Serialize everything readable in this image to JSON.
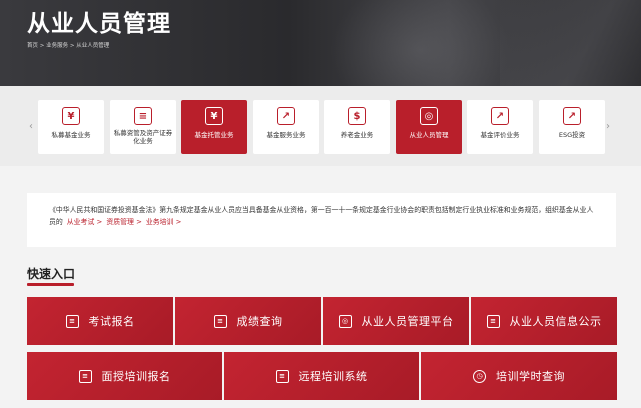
{
  "hero": {
    "title": "从业人员管理",
    "breadcrumb": "首页 > 业务服务 > 从业人员管理"
  },
  "categories": [
    {
      "label": "私募基金业务",
      "icon": "yen-coin-icon",
      "glyph": "¥",
      "active": false
    },
    {
      "label": "私募资管及资产证券化业务",
      "icon": "stacked-coins-icon",
      "glyph": "≡",
      "active": false
    },
    {
      "label": "基金托管业务",
      "icon": "money-hand-icon",
      "glyph": "¥",
      "active": true
    },
    {
      "label": "基金服务业务",
      "icon": "bar-chart-icon",
      "glyph": "↗",
      "active": false
    },
    {
      "label": "养老金业务",
      "icon": "banknote-icon",
      "glyph": "$",
      "active": false
    },
    {
      "label": "从业人员管理",
      "icon": "people-icon",
      "glyph": "◎",
      "active": true
    },
    {
      "label": "基金评价业务",
      "icon": "line-chart-icon",
      "glyph": "↗",
      "active": false
    },
    {
      "label": "ESG投资",
      "icon": "trend-chart-icon",
      "glyph": "↗",
      "active": false
    }
  ],
  "intro": {
    "text": "《中华人民共和国证券投资基金法》第九条规定基金从业人员应当具备基金从业资格，第一百一十一条规定基金行业协会的职责包括制定行业执业标准和业务规范，组织基金从业人员的",
    "links": [
      "从业考试",
      "资质管理",
      "业务培训"
    ]
  },
  "quick_entry": {
    "title": "快速入口",
    "row1": [
      {
        "label": "考试报名",
        "icon": "pen-list-icon",
        "glyph": "≡"
      },
      {
        "label": "成绩查询",
        "icon": "document-icon",
        "glyph": "≡"
      },
      {
        "label": "从业人员管理平台",
        "icon": "id-card-icon",
        "glyph": "◎"
      },
      {
        "label": "从业人员信息公示",
        "icon": "briefcase-icon",
        "glyph": "≡"
      }
    ],
    "row2": [
      {
        "label": "面授培训报名",
        "icon": "chat-icon",
        "glyph": "≡"
      },
      {
        "label": "远程培训系统",
        "icon": "monitor-icon",
        "glyph": "≡"
      },
      {
        "label": "培训学时查询",
        "icon": "clock-icon",
        "glyph": "◷"
      }
    ]
  },
  "colors": {
    "accent": "#b91f2b",
    "hero_bg": "#2f2f32",
    "page_bg": "#f3f3f3"
  }
}
